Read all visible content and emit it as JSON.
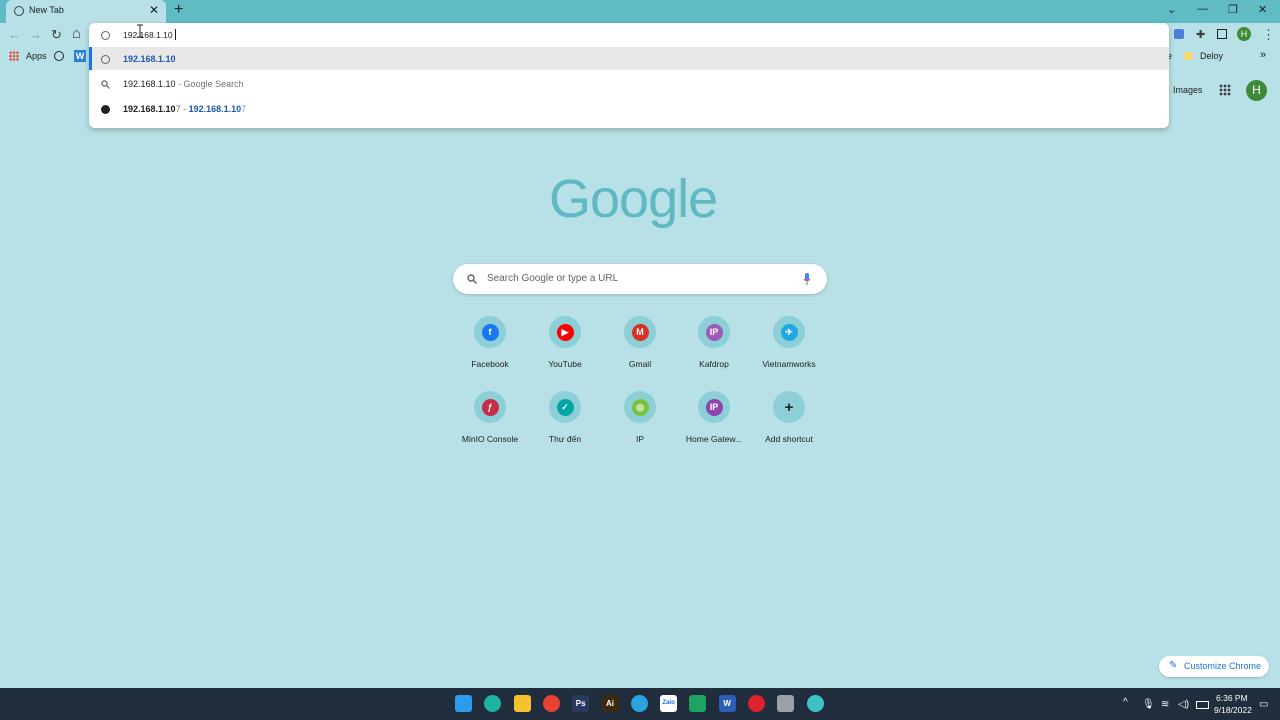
{
  "tab": {
    "title": "New Tab",
    "close": "✕",
    "new_tab": "+"
  },
  "window_buttons": {
    "dropdown": "⌄",
    "minimize": "—",
    "restore": "❐",
    "close": "✕"
  },
  "toolbar": {
    "back": "←",
    "forward": "→",
    "reload": "↻",
    "home": "⌂",
    "extensions": "✚",
    "menu": "⋮",
    "profile": "H"
  },
  "bookmarks": {
    "apps_label": "Apps",
    "w_label": "W",
    "folder_label": "Deloy",
    "e_fragment": "e",
    "more": "»"
  },
  "omnibox": {
    "input_value": "192.168.1.10",
    "suggestions": [
      {
        "text": "192.168.1.10"
      },
      {
        "text": "192.168.1.10",
        "suffix": " - Google Search"
      },
      {
        "text_bold": "192.168.1.10",
        "text_tail": "7",
        "sep": " - ",
        "link_bold": "192.168.1.10",
        "link_tail": "7"
      }
    ]
  },
  "header_links": {
    "images": "Images",
    "avatar": "H"
  },
  "logo": {
    "text": "Google"
  },
  "search": {
    "placeholder": "Search Google or type a URL"
  },
  "shortcuts": [
    {
      "label": "Facebook",
      "glyph": "f",
      "color": "#1877f2"
    },
    {
      "label": "YouTube",
      "glyph": "▶",
      "color": "#ff0000"
    },
    {
      "label": "Gmail",
      "glyph": "M",
      "color": "#d93025"
    },
    {
      "label": "Kafdrop",
      "glyph": "IP",
      "color": "#9c5bb5"
    },
    {
      "label": "Vietnamworks",
      "glyph": "✈",
      "color": "#1ea7e0"
    },
    {
      "label": "MinIO Console",
      "glyph": "ƒ",
      "color": "#c72c48"
    },
    {
      "label": "Thư đến",
      "glyph": "✓",
      "color": "#00a6a6"
    },
    {
      "label": "IP",
      "glyph": "◎",
      "color": "#7cc242"
    },
    {
      "label": "Home Gatew...",
      "glyph": "IP",
      "color": "#8e44ad"
    },
    {
      "label": "Add shortcut",
      "glyph": "+",
      "color": "#202124"
    }
  ],
  "customize": {
    "label": "Customize Chrome"
  },
  "taskbar": {
    "time": "6:36 PM",
    "date": "9/18/2022",
    "apps": [
      {
        "name": "windows-start",
        "color": "#2b9cf0"
      },
      {
        "name": "edge",
        "color": "#1fb4a0"
      },
      {
        "name": "file-explorer",
        "color": "#f5c12e"
      },
      {
        "name": "chrome",
        "color": "#e94235"
      },
      {
        "name": "photoshop",
        "color": "#2a3a5e",
        "text": "Ps"
      },
      {
        "name": "illustrator",
        "color": "#3a2a10",
        "text": "Ai"
      },
      {
        "name": "telegram",
        "color": "#2aa3e0"
      },
      {
        "name": "zalo",
        "color": "#ffffff",
        "text": "Zalo"
      },
      {
        "name": "app-green",
        "color": "#1da362"
      },
      {
        "name": "word",
        "color": "#2b5fb5",
        "text": "W"
      },
      {
        "name": "opera",
        "color": "#e0202a"
      },
      {
        "name": "settings",
        "color": "#9aa0a6"
      },
      {
        "name": "chrome-active",
        "color": "#3dc2c6"
      }
    ]
  }
}
